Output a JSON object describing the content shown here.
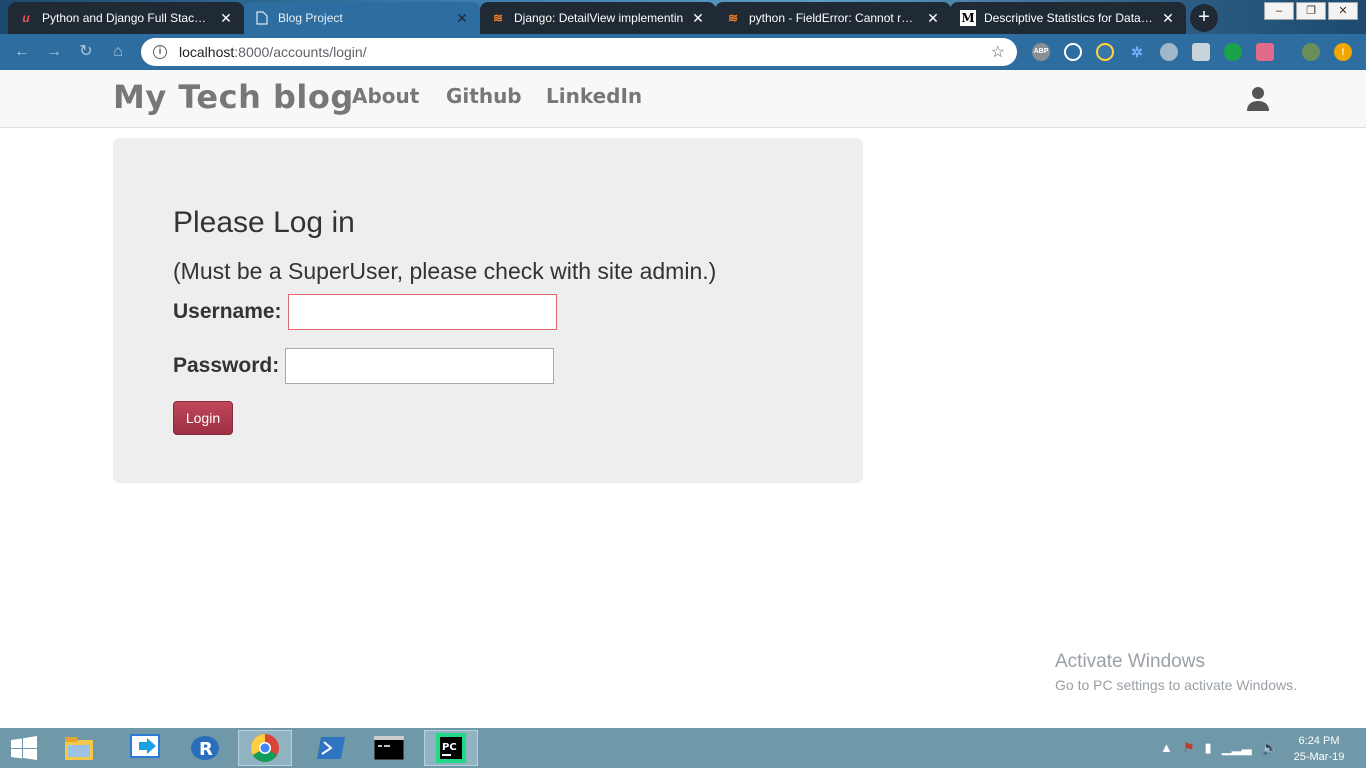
{
  "browser": {
    "tabs": [
      {
        "title": "Python and Django Full Stack W",
        "icon": "udemy-icon"
      },
      {
        "title": "Blog Project",
        "icon": "page-icon"
      },
      {
        "title": "Django: DetailView implementin",
        "icon": "stackoverflow-icon"
      },
      {
        "title": "python - FieldError: Cannot reso",
        "icon": "stackoverflow-icon"
      },
      {
        "title": "Descriptive Statistics for Data Sc",
        "icon": "medium-icon"
      }
    ],
    "url_host": "localhost",
    "url_path": ":8000/accounts/login/",
    "extensions": [
      "ABP",
      "speed-icon",
      "python-icon",
      "puzzle-icon",
      "globe-icon",
      "bulb-icon",
      "leaf-icon",
      "video-icon",
      "avatar",
      "alert-icon"
    ]
  },
  "navbar": {
    "brand": "My Tech blog",
    "links": [
      "About",
      "Github",
      "LinkedIn"
    ]
  },
  "login": {
    "heading": "Please Log in",
    "subheading": "(Must be a SuperUser, please check with site admin.)",
    "username_label": "Username:",
    "password_label": "Password:",
    "button_label": "Login",
    "username_value": "",
    "password_value": ""
  },
  "watermark": {
    "line1": "Activate Windows",
    "line2": "Go to PC settings to activate Windows."
  },
  "taskbar": {
    "time": "6:24 PM",
    "date": "25-Mar-19"
  },
  "colors": {
    "login_button": "#ab3a4f",
    "jumbotron": "#eeeeee",
    "navbar_text": "#777777",
    "toolbar": "#2e6da0"
  }
}
